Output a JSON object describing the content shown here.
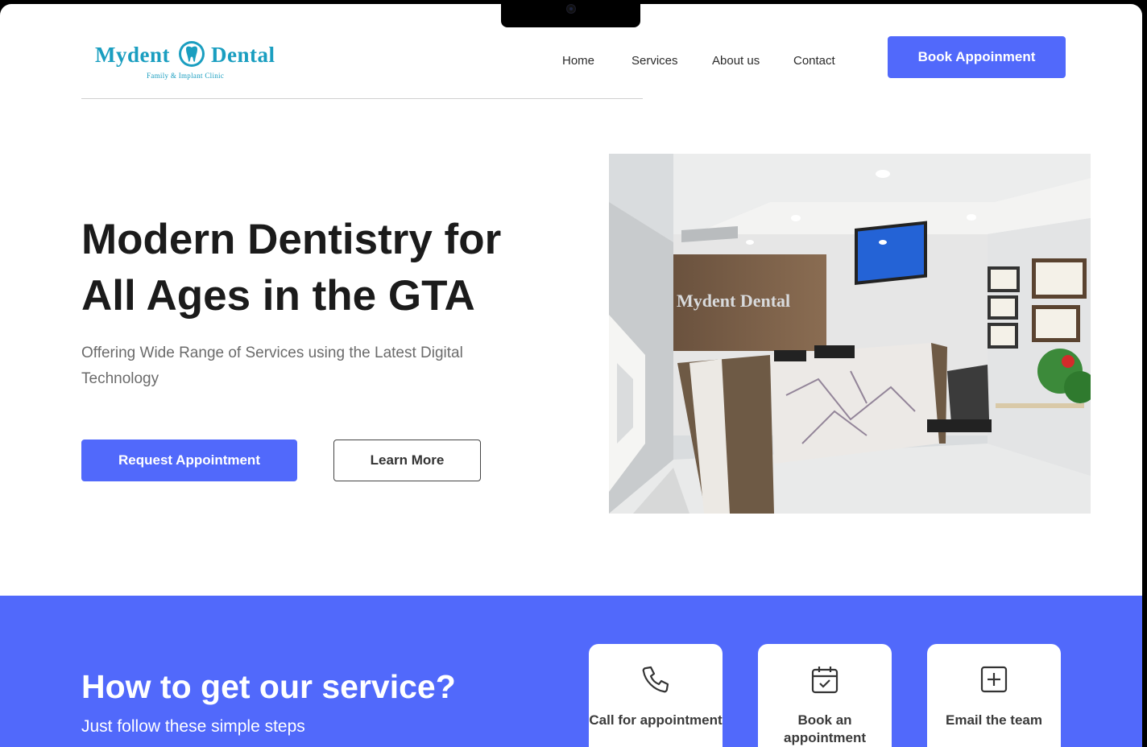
{
  "brand": {
    "name_left": "Mydent",
    "name_right": "Dental",
    "tagline": "Family & Implant Clinic",
    "color": "#1a9ec0"
  },
  "nav": {
    "items": [
      "Home",
      "Services",
      "About us",
      "Contact"
    ],
    "cta_label": "Book Appoinment"
  },
  "hero": {
    "title": "Modern Dentistry for All Ages in the GTA",
    "subtitle": "Offering Wide Range of Services using the Latest Digital Technology",
    "primary_button": "Request Appointment",
    "secondary_button": "Learn More",
    "image_sign_text": "Mydent Dental"
  },
  "service_section": {
    "title": "How to get our service?",
    "subtitle": "Just follow these simple steps",
    "cards": [
      {
        "label": "Call for appointment",
        "icon": "phone-icon"
      },
      {
        "label": "Book an appointment",
        "icon": "calendar-check-icon"
      },
      {
        "label": "Email the team",
        "icon": "plus-square-icon"
      }
    ]
  },
  "colors": {
    "accent": "#5169fb",
    "heading": "#1b1b1b",
    "body_text": "#6b6b6b"
  }
}
